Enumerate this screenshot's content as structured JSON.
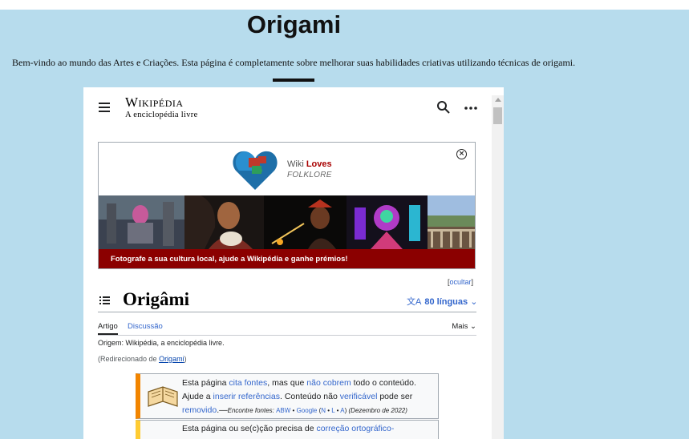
{
  "page": {
    "title": "Origami",
    "intro": "Bem-vindo ao mundo das Artes e Criações. Esta página é completamente sobre melhorar suas habilidades criativas utilizando técnicas de origami."
  },
  "wiki": {
    "logo_name": "Wikipédia",
    "logo_tagline": "A enciclopédia livre",
    "banner": {
      "brand_line1_prefix": "Wiki ",
      "brand_line1_bold": "Loves",
      "brand_line2": "FOLKLORE",
      "cta": "Fotografe a sua cultura local, ajude a Wikipédia e ganhe prémios!",
      "close_symbol": "×"
    },
    "hide_link": "[ocultar]",
    "hide_link_open": "[",
    "hide_link_word": "ocultar",
    "hide_link_close": "]",
    "article_title": "Origâmi",
    "languages": "80 línguas",
    "tabs": {
      "article": "Artigo",
      "discussion": "Discussão",
      "more": "Mais"
    },
    "origin": "Origem: Wikipédia, a enciclopédia livre.",
    "redirect_prefix": "(Redirecionado de ",
    "redirect_link": "Origami",
    "redirect_suffix": ")",
    "notice1": {
      "t1": "Esta página ",
      "l1": "cita fontes",
      "t2": ", mas que ",
      "l2": "não cobrem",
      "t3": " todo o conteúdo. Ajude a ",
      "l3": "inserir referências",
      "t4": ". Conteúdo não ",
      "l4": "verificável",
      "t5": " pode ser ",
      "l5": "removido",
      "t6": ".—",
      "find": "Encontre fontes: ",
      "abw": "ABW",
      "sep1": " • ",
      "google": "Google",
      "paren_open": " (",
      "n": "N",
      "l": "L",
      "a": "A",
      "paren_close": ")",
      "date": " (Dezembro de 2022)"
    },
    "notice2": {
      "t1": "Esta página ou se(c)ção precisa de ",
      "l1": "correção ortográfico-"
    }
  }
}
